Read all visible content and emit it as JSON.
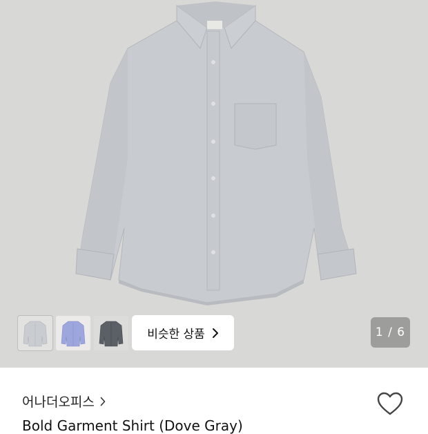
{
  "gallery": {
    "thumbnails": [
      {
        "name": "gray-shirt",
        "color": "#c9cdd2"
      },
      {
        "name": "blue-shirt",
        "color": "#9ea7dd"
      },
      {
        "name": "charcoal-shirt",
        "color": "#5b5f66"
      }
    ],
    "similar_label": "비슷한 상품",
    "counter": "1 / 6"
  },
  "product": {
    "brand": "어나더오피스",
    "title": "Bold Garment Shirt (Dove Gray)"
  },
  "colors": {
    "background": "#d8d8d6",
    "shirt": "#c8ccd0"
  }
}
